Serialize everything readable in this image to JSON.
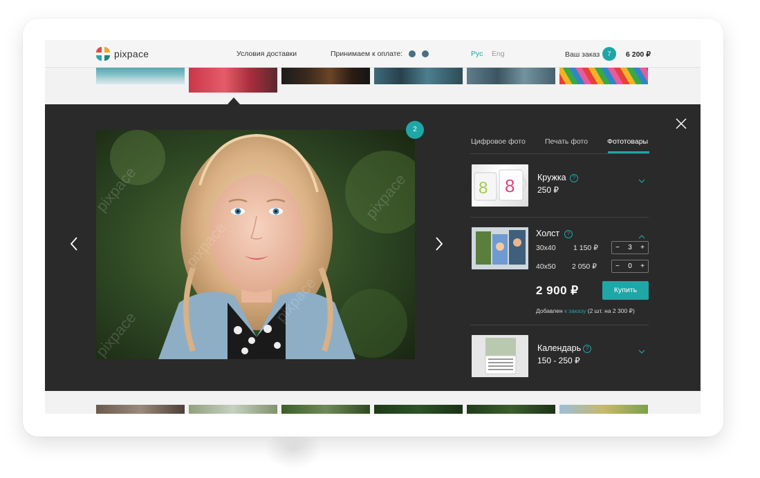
{
  "header": {
    "logo_text": "pixpace",
    "delivery_link": "Условия доставки",
    "payment_label": "Принимаем к оплате:",
    "lang_ru": "Рус",
    "lang_en": "Eng",
    "order_label": "Ваш заказ",
    "order_count": "7",
    "order_total": "6 200 ₽"
  },
  "viewer": {
    "photo_index_badge": "2",
    "watermark": "pixpace",
    "tabs": [
      {
        "label": "Цифровое фото"
      },
      {
        "label": "Печать фото"
      },
      {
        "label": "Фототовары"
      }
    ],
    "products": [
      {
        "name": "Кружка",
        "price": "250 ₽"
      },
      {
        "name": "Холст",
        "sizes": [
          {
            "size": "30x40",
            "price": "1 150 ₽",
            "qty": "3"
          },
          {
            "size": "40x50",
            "price": "2 050 ₽",
            "qty": "0"
          }
        ],
        "total": "2 900 ₽",
        "buy_label": "Купить",
        "added_prefix": "Добавлен",
        "added_link": "к заказу",
        "added_suffix": "(2 шт. на 2 300 ₽)"
      },
      {
        "name": "Календарь",
        "price": "150 - 250 ₽"
      }
    ],
    "stepper_minus": "−",
    "stepper_plus": "+",
    "help_glyph": "?"
  },
  "colors": {
    "accent": "#1fa6a6",
    "viewer_bg": "#2a2a2a",
    "header_bg": "#f5f5f5"
  },
  "icons": [
    "logo-icon",
    "payment-icon",
    "close-icon",
    "arrow-left-icon",
    "arrow-right-icon",
    "help-icon",
    "chevron-down-icon",
    "chevron-up-icon"
  ]
}
